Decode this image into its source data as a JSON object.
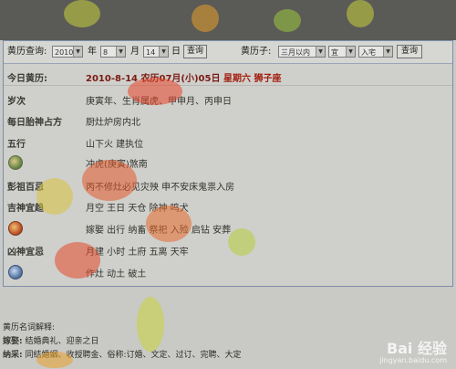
{
  "search": {
    "label": "黄历查询:",
    "year": "2010",
    "year_unit": "年",
    "month": "8",
    "month_unit": "月",
    "day": "14",
    "day_unit": "日",
    "query_button": "查询",
    "pick_label": "黄历子:",
    "range": "三月以内",
    "yiji": "宜",
    "event": "入宅",
    "pick_button": "查询"
  },
  "rows": {
    "today_label": "今日黄历:",
    "today_date": "2010-8-14",
    "today_lunar": "农历07月(小)05日",
    "today_weekday": "星期六",
    "today_star": "狮子座",
    "suici_label": "岁次",
    "suici_value": "庚寅年、生肖属虎、甲申月、丙申日",
    "taishen_label": "每日胎神占方",
    "taishen_value": "厨灶炉房内北",
    "wuxing_label": "五行",
    "wuxing_value": "山下火 建执位",
    "chong_value": "冲虎(庚寅)煞南",
    "pengzu_label": "彭祖百忌",
    "pengzu_value": "丙不修灶必见灾殃 申不安床鬼祟入房",
    "jishen_label": "吉神宜趋",
    "jishen_value": "月空 王日 天仓 除神 鸣犬",
    "yi_value": "嫁娶 出行 纳畜 祭祀 入殓 启钻 安葬",
    "xiongshen_label": "凶神宜忌",
    "xiongshen_value": "月建 小时 土府 五离 天牢",
    "ji_value": "作灶 动土 破土"
  },
  "glossary": {
    "title": "黄历名词解释:",
    "line1_term": "嫁娶:",
    "line1_text": "结婚典礼、迎亲之日",
    "line2_term": "纳采:",
    "line2_text": "同结婚姻、收授聘金、俗称:订婚、文定、过订、完聘、大定"
  },
  "watermark": {
    "brand": "Bai  经验",
    "url": "jingyan.baidu.com"
  }
}
